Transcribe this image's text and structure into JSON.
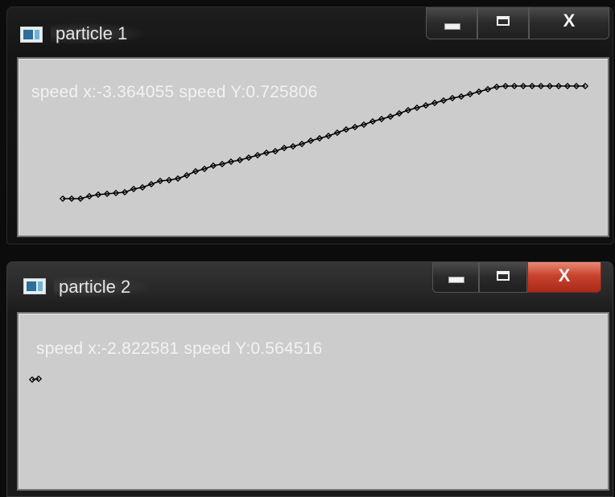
{
  "windows": [
    {
      "title": "particle 1",
      "speed_text": "speed x:-3.364055 speed Y:0.725806",
      "controls": {
        "minimize": "minimize",
        "maximize": "maximize",
        "close": "X"
      },
      "trail": [
        [
          55,
          174
        ],
        [
          66,
          174
        ],
        [
          77,
          174
        ],
        [
          88,
          171
        ],
        [
          99,
          169
        ],
        [
          110,
          168
        ],
        [
          121,
          167
        ],
        [
          132,
          166
        ],
        [
          143,
          162
        ],
        [
          154,
          160
        ],
        [
          165,
          156
        ],
        [
          176,
          152
        ],
        [
          187,
          151
        ],
        [
          198,
          149
        ],
        [
          209,
          145
        ],
        [
          220,
          140
        ],
        [
          231,
          137
        ],
        [
          242,
          133
        ],
        [
          253,
          131
        ],
        [
          264,
          128
        ],
        [
          275,
          126
        ],
        [
          286,
          123
        ],
        [
          297,
          120
        ],
        [
          308,
          117
        ],
        [
          319,
          115
        ],
        [
          330,
          111
        ],
        [
          341,
          109
        ],
        [
          352,
          106
        ],
        [
          363,
          102
        ],
        [
          374,
          99
        ],
        [
          385,
          96
        ],
        [
          396,
          92
        ],
        [
          407,
          88
        ],
        [
          418,
          85
        ],
        [
          429,
          82
        ],
        [
          440,
          78
        ],
        [
          451,
          75
        ],
        [
          462,
          72
        ],
        [
          473,
          68
        ],
        [
          484,
          64
        ],
        [
          495,
          61
        ],
        [
          506,
          58
        ],
        [
          517,
          55
        ],
        [
          528,
          52
        ],
        [
          539,
          49
        ],
        [
          550,
          47
        ],
        [
          561,
          44
        ],
        [
          572,
          41
        ],
        [
          583,
          38
        ],
        [
          594,
          35
        ],
        [
          605,
          34
        ],
        [
          616,
          34
        ],
        [
          627,
          34
        ],
        [
          638,
          34
        ],
        [
          649,
          34
        ],
        [
          660,
          34
        ],
        [
          671,
          34
        ],
        [
          682,
          34
        ],
        [
          693,
          34
        ],
        [
          704,
          34
        ]
      ]
    },
    {
      "title": "particle 2",
      "speed_text": "speed x:-2.822581 speed Y:0.564516",
      "controls": {
        "minimize": "minimize",
        "maximize": "maximize",
        "close": "X"
      },
      "trail": [
        [
          17,
          82
        ],
        [
          25,
          81
        ]
      ]
    }
  ],
  "colors": {
    "client_bg": "#cccccc",
    "trail": "#000000",
    "close_active": "#c9432d",
    "text": "#f2f2f2"
  }
}
